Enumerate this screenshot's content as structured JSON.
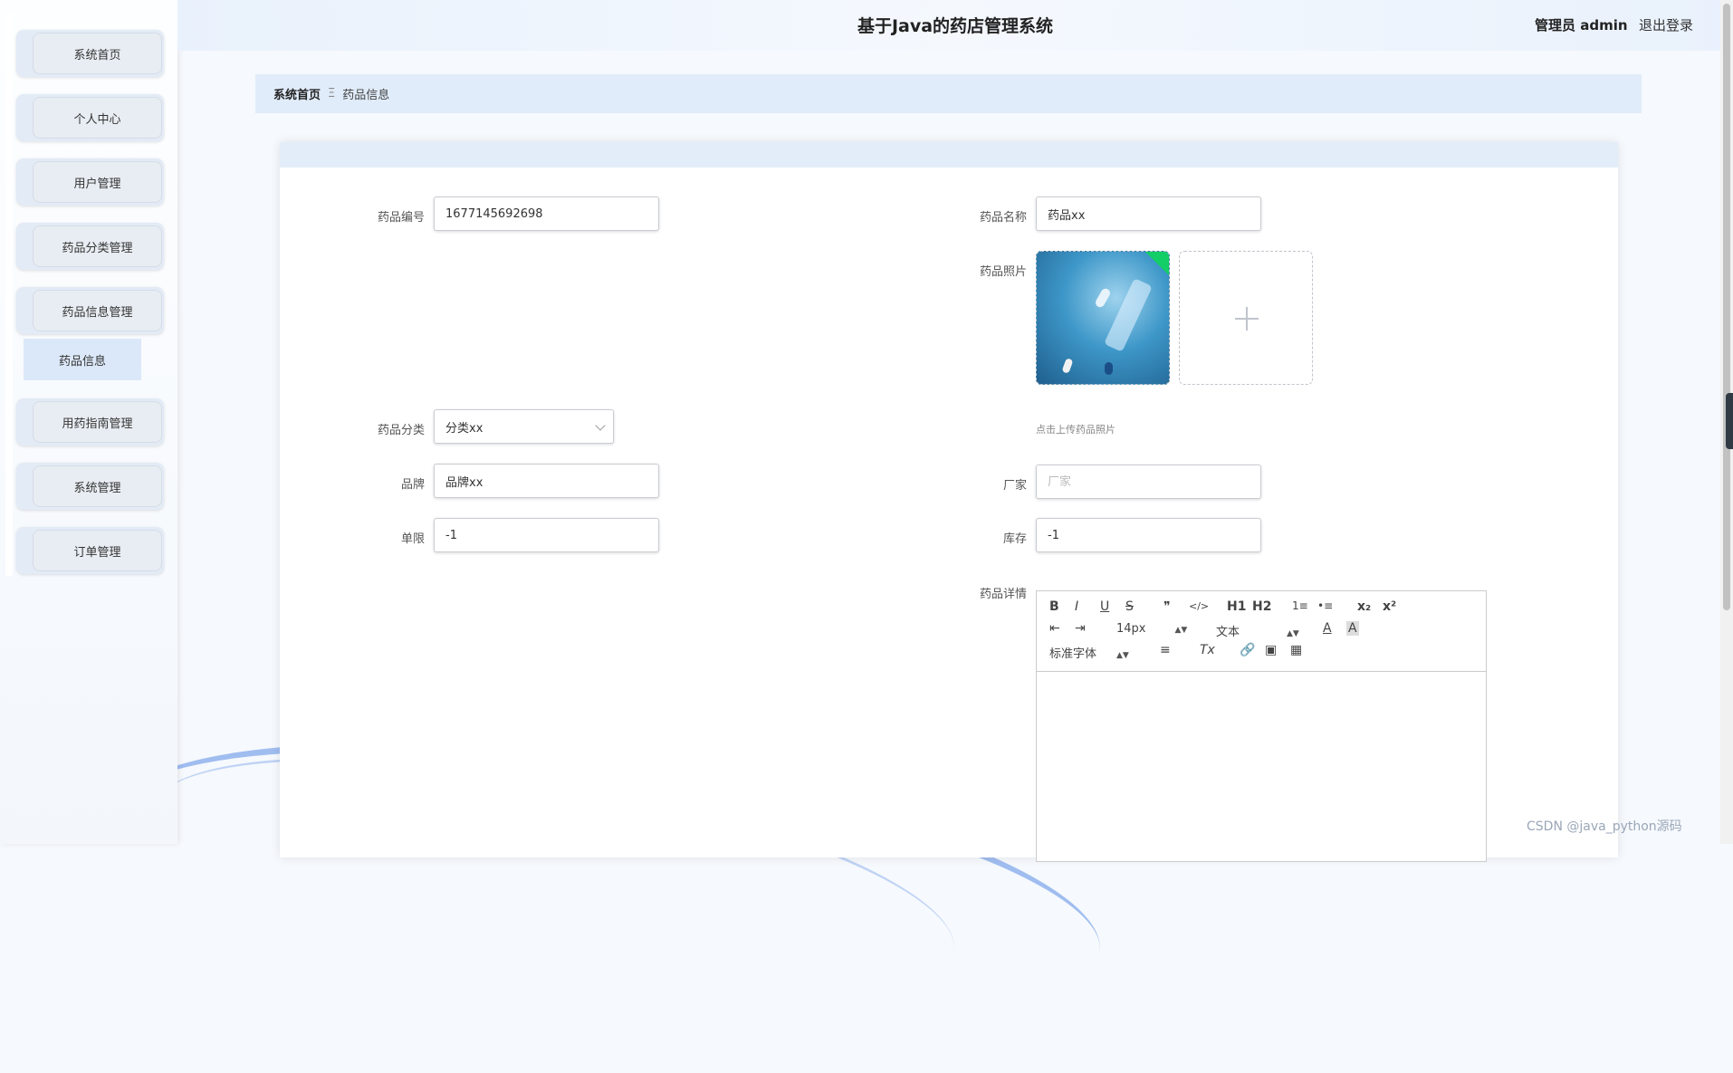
{
  "header": {
    "title": "基于Java的药店管理系统",
    "user": "管理员 admin",
    "logout": "退出登录"
  },
  "sidebar": {
    "items": [
      {
        "label": "系统首页"
      },
      {
        "label": "个人中心"
      },
      {
        "label": "用户管理"
      },
      {
        "label": "药品分类管理"
      },
      {
        "label": "药品信息管理"
      },
      {
        "label": "用药指南管理"
      },
      {
        "label": "系统管理"
      },
      {
        "label": "订单管理"
      }
    ],
    "submenu": "药品信息"
  },
  "breadcrumb": {
    "home": "系统首页",
    "separator": "Ξ",
    "current": "药品信息"
  },
  "form": {
    "code": {
      "label": "药品编号",
      "value": "1677145692698"
    },
    "name": {
      "label": "药品名称",
      "value": "药品xx"
    },
    "photo": {
      "label": "药品照片",
      "hint": "点击上传药品照片"
    },
    "category": {
      "label": "药品分类",
      "value": "分类xx"
    },
    "brand": {
      "label": "品牌",
      "value": "品牌xx"
    },
    "maker": {
      "label": "厂家",
      "value": "",
      "placeholder": "厂家"
    },
    "limit": {
      "label": "单限",
      "value": "-1"
    },
    "stock": {
      "label": "库存",
      "value": "-1"
    },
    "detail": {
      "label": "药品详情"
    }
  },
  "editor": {
    "row1": [
      "B",
      "I",
      "U",
      "S",
      "❞",
      "</>",
      "H1",
      "H2",
      "1≡",
      "•≡",
      "x₂",
      "x²"
    ],
    "font_size": "14px",
    "text_style": "文本",
    "font_family": "标准字体"
  },
  "watermark": "CSDN @java_python源码",
  "colors": {
    "accent": "#e1ecfa",
    "sidebar_item": "#e8edf3",
    "upload_success": "#13ce66"
  }
}
